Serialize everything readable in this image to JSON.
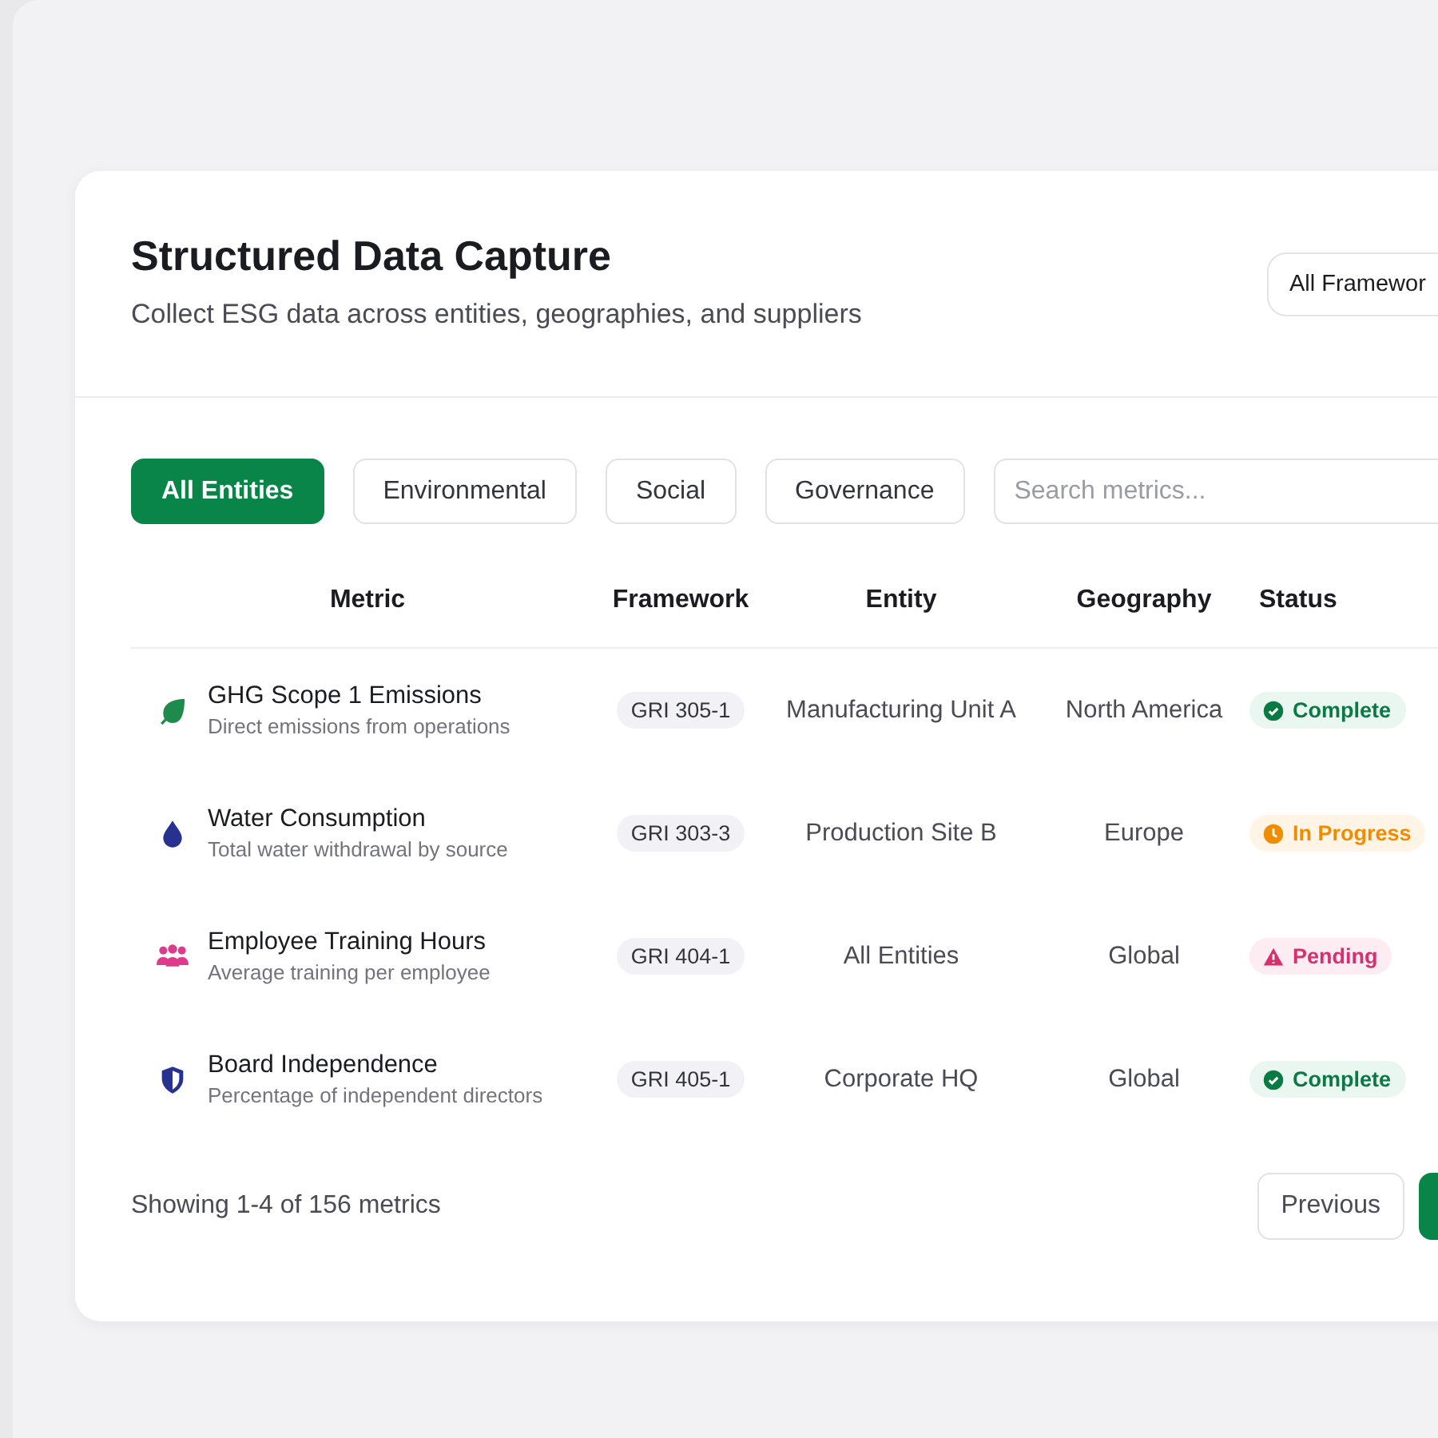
{
  "header": {
    "title": "Structured Data Capture",
    "subtitle": "Collect ESG data across entities, geographies, and suppliers",
    "framework_select": "All Framewor"
  },
  "filters": [
    {
      "label": "All Entities",
      "selected": true
    },
    {
      "label": "Environmental",
      "selected": false
    },
    {
      "label": "Social",
      "selected": false
    },
    {
      "label": "Governance",
      "selected": false
    }
  ],
  "search": {
    "placeholder": "Search metrics..."
  },
  "table": {
    "columns": [
      "Metric",
      "Framework",
      "Entity",
      "Geography",
      "Status"
    ],
    "rows": [
      {
        "kind": "leaf",
        "name": "GHG Scope 1 Emissions",
        "description": "Direct emissions from operations",
        "framework": "GRI 305-1",
        "entity": "Manufacturing Unit A",
        "geography": "North America",
        "status": {
          "kind": "complete",
          "label": "Complete"
        }
      },
      {
        "kind": "drop",
        "name": "Water Consumption",
        "description": "Total water withdrawal by source",
        "framework": "GRI 303-3",
        "entity": "Production Site B",
        "geography": "Europe",
        "status": {
          "kind": "in_progress",
          "label": "In Progress"
        }
      },
      {
        "kind": "people",
        "name": "Employee Training Hours",
        "description": "Average training per employee",
        "framework": "GRI 404-1",
        "entity": "All Entities",
        "geography": "Global",
        "status": {
          "kind": "pending",
          "label": "Pending"
        }
      },
      {
        "kind": "shield",
        "name": "Board Independence",
        "description": "Percentage of independent directors",
        "framework": "GRI 405-1",
        "entity": "Corporate HQ",
        "geography": "Global",
        "status": {
          "kind": "complete",
          "label": "Complete"
        }
      }
    ]
  },
  "footer": {
    "summary": "Showing 1-4 of 156 metrics",
    "previous": "Previous"
  }
}
